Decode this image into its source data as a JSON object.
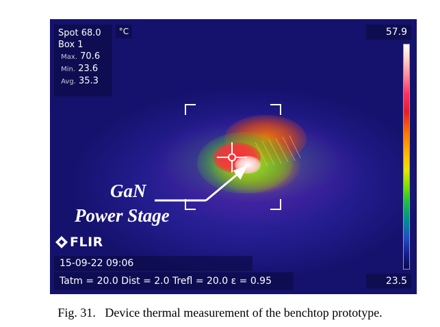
{
  "thermal_image": {
    "spot_label": "Spot",
    "spot_value": "68.0",
    "unit": "°C",
    "box_label": "Box 1",
    "max_label": "Max.",
    "max_value": "70.6",
    "min_label": "Min.",
    "min_value": "23.6",
    "avg_label": "Avg.",
    "avg_value": "35.3",
    "scale_max": "57.9",
    "scale_min": "23.5",
    "logo_text": "FLIR",
    "datetime": "15-09-22 09:06",
    "parameters": "Tatm = 20.0  Dist = 2.0  Trefl = 20.0  ε = 0.95",
    "annotation_line1": "GaN",
    "annotation_line2": "Power Stage"
  },
  "caption": {
    "label": "Fig. 31.",
    "text": "Device thermal measurement of the benchtop prototype."
  },
  "colors": {
    "background": "#15126e",
    "hotspot": "#ffffff",
    "warm": "#ff8a00",
    "cool": "#231c8e"
  }
}
